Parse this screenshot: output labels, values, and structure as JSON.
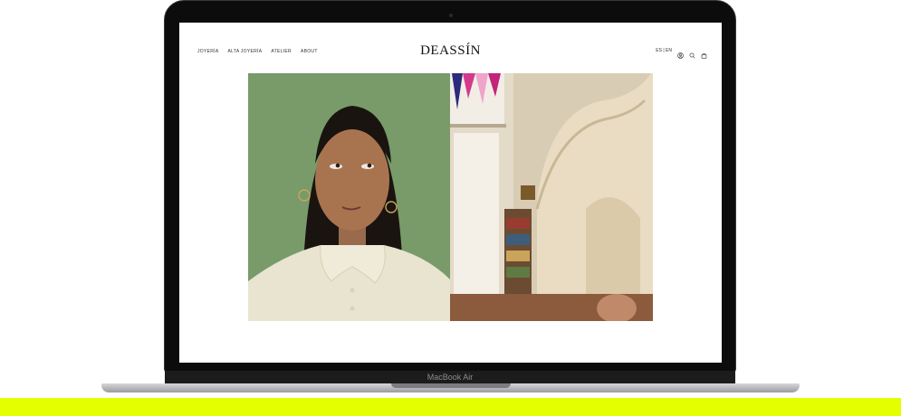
{
  "device": {
    "model_label": "MacBook Air"
  },
  "site": {
    "brand": "DEASSÍN",
    "nav": [
      "JOYERÍA",
      "ALTA JOYERÍA",
      "ATELIER",
      "ABOUT"
    ],
    "lang_switch": "ES | EN",
    "icons": [
      "account-icon",
      "search-icon",
      "bag-icon"
    ]
  },
  "hero": {
    "left_image": "portrait-of-woman",
    "right_image": "spiral-staircase-interior"
  },
  "colors": {
    "accent_band": "#e4ff00",
    "portrait_bg": "#7da06d"
  }
}
